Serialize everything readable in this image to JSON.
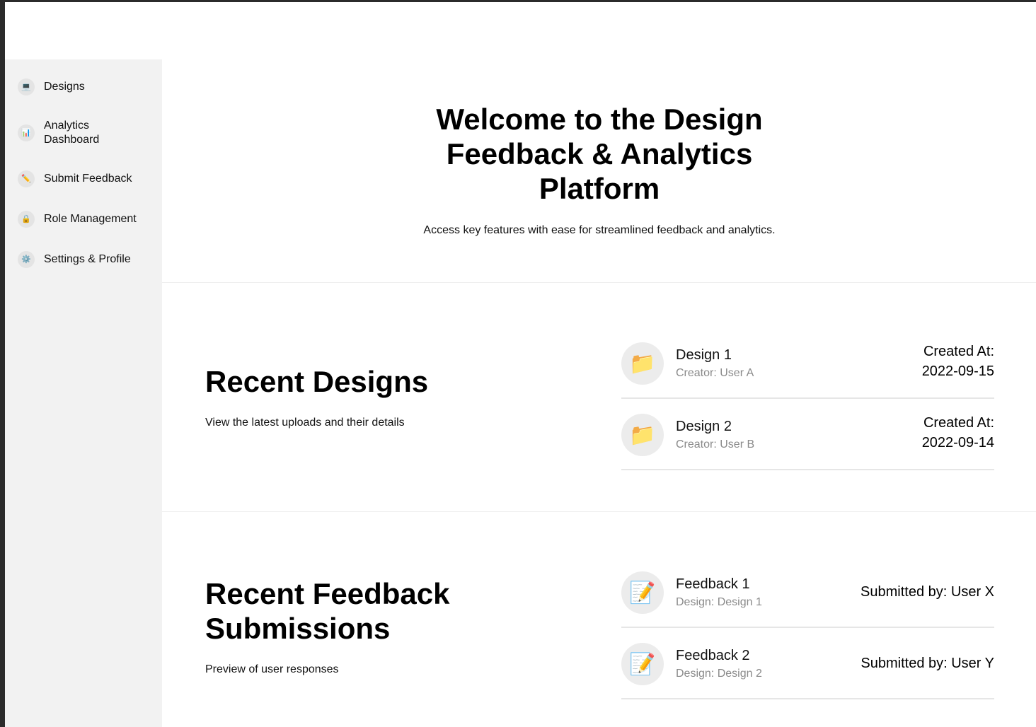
{
  "sidebar": {
    "items": [
      {
        "label": "Designs",
        "icon": "💻"
      },
      {
        "label": "Analytics Dashboard",
        "icon": "📊"
      },
      {
        "label": "Submit Feedback",
        "icon": "✏️"
      },
      {
        "label": "Role Management",
        "icon": "🔒"
      },
      {
        "label": "Settings & Profile",
        "icon": "⚙️"
      }
    ]
  },
  "hero": {
    "title": "Welcome to the Design Feedback & Analytics Platform",
    "subtitle": "Access key features with ease for streamlined feedback and analytics."
  },
  "recent_designs": {
    "title": "Recent Designs",
    "subtitle": "View the latest uploads and their details",
    "items": [
      {
        "icon": "📁",
        "name": "Design 1",
        "creator": "Creator: User A",
        "created_label": "Created At:",
        "created_date": "2022-09-15"
      },
      {
        "icon": "📁",
        "name": "Design 2",
        "creator": "Creator: User B",
        "created_label": "Created At:",
        "created_date": "2022-09-14"
      }
    ]
  },
  "recent_feedback": {
    "title": "Recent Feedback Submissions",
    "subtitle": "Preview of user responses",
    "items": [
      {
        "icon": "📝",
        "name": "Feedback 1",
        "design": "Design: Design 1",
        "submitted_by": "Submitted by: User X"
      },
      {
        "icon": "📝",
        "name": "Feedback 2",
        "design": "Design: Design 2",
        "submitted_by": "Submitted by: User Y"
      }
    ]
  }
}
